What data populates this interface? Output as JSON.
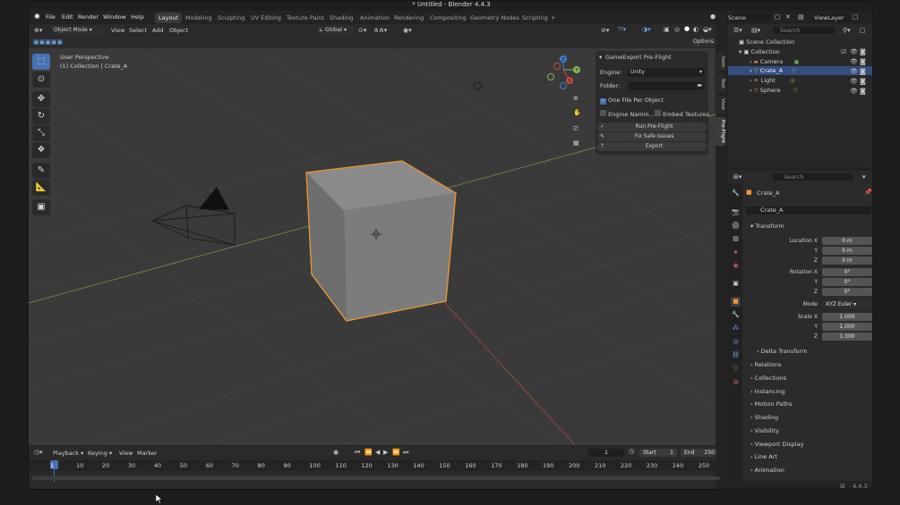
{
  "window": {
    "title": "* Untitled - Blender 4.4.3"
  },
  "menubar": {
    "menus": [
      "File",
      "Edit",
      "Render",
      "Window",
      "Help"
    ],
    "workspaces": [
      "Layout",
      "Modeling",
      "Sculpting",
      "UV Editing",
      "Texture Paint",
      "Shading",
      "Animation",
      "Rendering",
      "Compositing",
      "Geometry Nodes",
      "Scripting"
    ],
    "active_workspace": "Layout",
    "add_workspace": "+",
    "scene": "Scene",
    "view_layer": "ViewLayer"
  },
  "viewport_header": {
    "mode": "Object Mode",
    "menus": [
      "View",
      "Select",
      "Add",
      "Object"
    ],
    "transform_orientation": "Global",
    "options": "Options",
    "search_placeholder": "Search"
  },
  "viewport": {
    "perspective": "User Perspective",
    "collection_info": "(1) Collection | Crate_A",
    "gizmo_axes": [
      "Z",
      "Y",
      "X"
    ],
    "tools": [
      "select-box-icon",
      "cursor-icon",
      "move-icon",
      "rotate-icon",
      "scale-icon",
      "transform-icon",
      "annotate-icon",
      "measure-icon",
      "add-cube-icon"
    ],
    "active_tool": "select-box-icon",
    "side_tabs": [
      "Item",
      "Tool",
      "View",
      "Pre-Flight"
    ]
  },
  "gameexport_panel": {
    "title": "GameExport Pre-Flight",
    "engine_label": "Engine:",
    "engine_value": "Unity",
    "folder_label": "Folder:",
    "one_file_per_object": {
      "label": "One File Per Object",
      "checked": true
    },
    "engine_naming": {
      "label": "Engine Namin...",
      "checked": false
    },
    "embed_textures": {
      "label": "Embed Textures",
      "checked": false
    },
    "buttons": [
      "Run Pre-Flight",
      "Fix Safe Issues",
      "Export"
    ]
  },
  "outliner": {
    "search_placeholder": "Search",
    "root": "Scene Collection",
    "collection": "Collection",
    "items": [
      {
        "name": "Camera",
        "color": "#e8873a"
      },
      {
        "name": "Crate_A",
        "color": "#e8873a",
        "selected": true
      },
      {
        "name": "Light",
        "color": "#e8873a"
      },
      {
        "name": "Sphere",
        "color": "#e8873a"
      }
    ]
  },
  "properties": {
    "search_placeholder": "Search",
    "object_name": "Crate_A",
    "datablock_name": "Crate_A",
    "section": "Transform",
    "location_label": "Location X",
    "location": [
      "0 m",
      "0 m",
      "0 m"
    ],
    "rotation_label": "Rotation X",
    "rotation": [
      "0°",
      "0°",
      "0°"
    ],
    "mode_label": "Mode",
    "mode_value": "XYZ Euler",
    "scale_label": "Scale X",
    "scale": [
      "1.000",
      "1.000",
      "1.000"
    ],
    "axis_labels": [
      "Y",
      "Z"
    ],
    "subpanels": [
      "Delta Transform",
      "Relations",
      "Collections",
      "Instancing",
      "Motion Paths",
      "Shading",
      "Visibility",
      "Viewport Display",
      "Line Art",
      "Animation"
    ]
  },
  "timeline": {
    "menus": [
      "Playback",
      "Keying",
      "View",
      "Marker"
    ],
    "current_frame": "1",
    "start_label": "Start",
    "start": "1",
    "end_label": "End",
    "end": "250",
    "frame_ticks": [
      "1",
      "10",
      "20",
      "30",
      "40",
      "50",
      "60",
      "70",
      "80",
      "90",
      "100",
      "110",
      "120",
      "130",
      "140",
      "150",
      "160",
      "170",
      "180",
      "190",
      "200",
      "210",
      "220",
      "230",
      "240",
      "250"
    ]
  },
  "statusbar": {
    "version": "4.4.3"
  },
  "colors": {
    "accent": "#4772b3",
    "selection": "#f0962e",
    "viewport_bg": "#3a3a3a",
    "x_axis": "#c6473f",
    "y_axis": "#86b64f",
    "z_axis": "#3d7fd6"
  }
}
